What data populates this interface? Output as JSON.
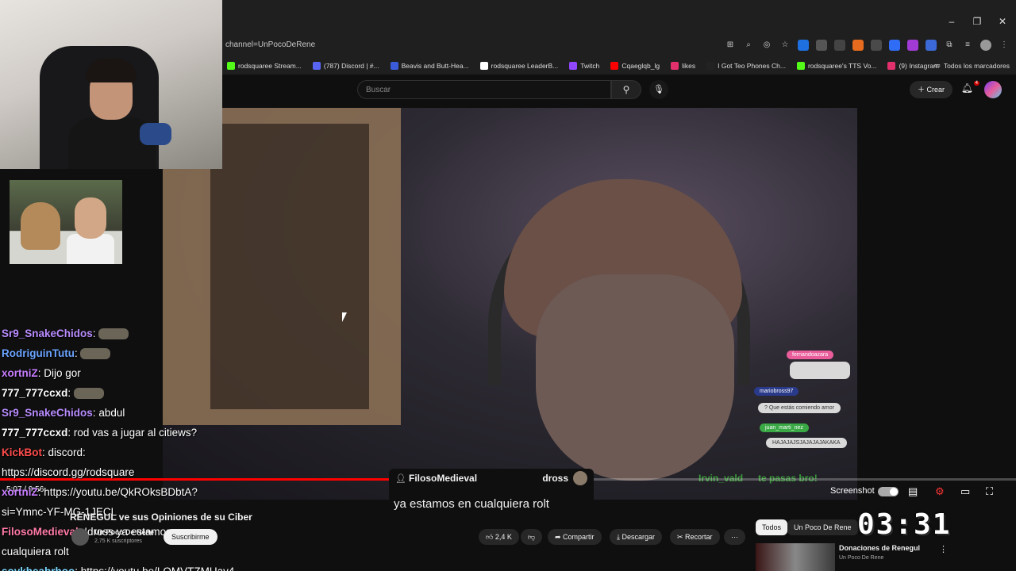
{
  "browser": {
    "url": "channel=UnPocoDeRene",
    "bookmarks": [
      {
        "label": "rodsquaree Stream...",
        "color": "#53fc18"
      },
      {
        "label": "(787) Discord | #...",
        "color": "#5865f2"
      },
      {
        "label": "Beavis and Butt-Hea...",
        "color": "#3b5bdb"
      },
      {
        "label": "rodsquaree LeaderB...",
        "color": "#ffffff"
      },
      {
        "label": "Twitch",
        "color": "#9146ff"
      },
      {
        "label": "Cqaeglqb_lg",
        "color": "#ff0000"
      },
      {
        "label": "likes",
        "color": "#e1306c"
      },
      {
        "label": "I Got Teo Phones Ch...",
        "color": "#222222"
      },
      {
        "label": "rodsquaree's TTS Vo...",
        "color": "#53fc18"
      },
      {
        "label": "(9) Instagram",
        "color": "#e1306c"
      }
    ],
    "all_bookmarks": "Todos los marcadores"
  },
  "youtube": {
    "search_placeholder": "Buscar",
    "create_label": "Crear",
    "notification_count": "4"
  },
  "chat": [
    {
      "user": "Sr9_SnakeChidos",
      "color": "#b98cff",
      "message": "",
      "emote": true
    },
    {
      "user": "RodriguinTutu",
      "color": "#6ba4ff",
      "message": "",
      "emote": true
    },
    {
      "user": "xortniZ",
      "color": "#c77dff",
      "message": "Dijo gor",
      "emote": false
    },
    {
      "user": "777_777ccxd",
      "color": "#ffffff",
      "message": "",
      "emote": true
    },
    {
      "user": "Sr9_SnakeChidos",
      "color": "#b98cff",
      "message": "abdul",
      "emote": false
    },
    {
      "user": "777_777ccxd",
      "color": "#ffffff",
      "message": "rod vas a jugar al citiews?",
      "emote": false
    },
    {
      "user": "KickBot",
      "color": "#ff4b4b",
      "message": "discord:",
      "emote": false
    },
    {
      "user": "",
      "color": "#ffffff",
      "message": "https://discord.gg/rodsquare",
      "emote": false
    },
    {
      "user": "xortniZ",
      "color": "#c77dff",
      "message": "https://youtu.be/QkROksBDbtA?",
      "emote": false
    },
    {
      "user": "",
      "color": "#ffffff",
      "message": "si=Ymnc-YF-MG-1JECL",
      "emote": false
    },
    {
      "user": "FilosoMedieval",
      "color": "#ff7aa8",
      "message": "!dross ya estamos en",
      "emote": false
    },
    {
      "user": "",
      "color": "#ffffff",
      "message": "cualquiera rolt",
      "emote": false
    },
    {
      "user": "soykheabrhoo",
      "color": "#7ad8ff",
      "message": "https://youtu.be/LOMVTZMUav4",
      "emote": false
    }
  ],
  "superchat": {
    "user": "FilosoMedieval",
    "target": "dross",
    "message": "ya estamos en cualquiera rolt"
  },
  "video_overlay": {
    "bubble1_name": "fernandoazara",
    "bubble2_name": "mariobross97",
    "bubble2_msg": "? Que estás comiendo amor",
    "bubble3_name": "juan_marti_nez",
    "bubble3_msg": "HAJAJAJSJAJAJAJAKAKA",
    "overlay_user": "Irvin_vald",
    "overlay_msg": "te pasas bro!"
  },
  "player": {
    "time": "5:07 / 9:56",
    "progress": 0.51,
    "screenshot_label": "Screenshot"
  },
  "video": {
    "title": "RENEGUL ve sus Opiniones de su Ciber",
    "channel": "Un Poco De Rene",
    "subscribers": "2,75 K suscriptores",
    "subscribe_label": "Suscribirme",
    "likes": "2,4 K",
    "share_label": "Compartir",
    "download_label": "Descargar",
    "clip_label": "Recortar"
  },
  "sidebar": {
    "chip_all": "Todos",
    "chip_channel": "Un Poco De Rene",
    "related_title": "Donaciones de Renegul",
    "related_channel": "Un Poco De Rene"
  },
  "timer": "03:31"
}
